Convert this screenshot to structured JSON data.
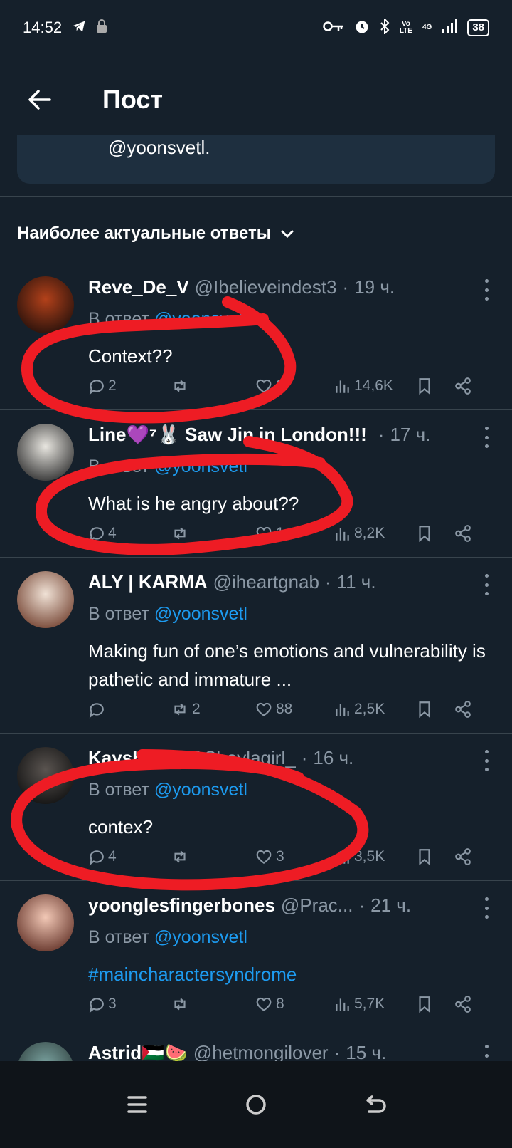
{
  "status_bar": {
    "time": "14:52",
    "battery": "38",
    "net_top": "Vo",
    "net_bottom": "LTE",
    "gen": "4G"
  },
  "header": {
    "title": "Пост",
    "quoted_handle": "@yoonsvetl."
  },
  "sort": {
    "label": "Наиболее актуальные ответы"
  },
  "reply_prefix": "В ответ",
  "reply_mention": "@yoonsvetl",
  "replies": [
    {
      "name": "Reve_De_V",
      "handle": "@Ibelieveindest3",
      "time": "19 ч.",
      "text": "Context??",
      "replies": "2",
      "retweets": "",
      "likes": "8",
      "views": "14,6K"
    },
    {
      "name": "Line💜⁷🐰 Saw Jin in London!!!",
      "handle": "",
      "time": "17 ч.",
      "text": "What is he angry about??",
      "replies": "4",
      "retweets": "",
      "likes": "1",
      "views": "8,2K"
    },
    {
      "name": "ALY | KARMA",
      "handle": "@iheartgnab",
      "time": "11 ч.",
      "text": "Making fun of one’s emotions and vulnerability is pathetic and immature ...",
      "replies": "",
      "retweets": "2",
      "likes": "88",
      "views": "2,5K"
    },
    {
      "name": "Kayshayla",
      "handle": "@Shaylagirl_",
      "time": "16 ч.",
      "text": "contex?",
      "replies": "4",
      "retweets": "",
      "likes": "3",
      "views": "3,5K"
    },
    {
      "name": "yoonglesfingerbones",
      "handle": "@Prac...",
      "time": "21 ч.",
      "text": "#maincharactersyndrome",
      "replies": "3",
      "retweets": "",
      "likes": "8",
      "views": "5,7K"
    },
    {
      "name": "Astrid🇵🇸🍉",
      "handle": "@hetmongilover",
      "time": "15 ч.",
      "text": "",
      "replies": "",
      "retweets": "",
      "likes": "",
      "views": ""
    }
  ],
  "colors": {
    "background": "#15202b",
    "accent": "#1d9bf0",
    "muted": "#8b98a5",
    "annotation": "#ee1c24"
  }
}
